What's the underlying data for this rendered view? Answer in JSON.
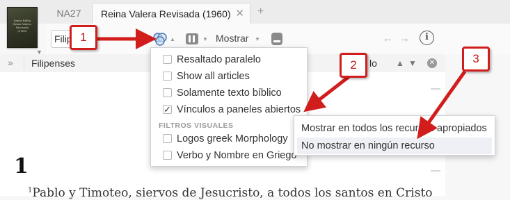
{
  "tabs": [
    {
      "label": "NA27",
      "active": false
    },
    {
      "label": "Reina Valera Revisada (1960)",
      "active": true
    }
  ],
  "tab_close_glyph": "✕",
  "tab_add_glyph": "+",
  "book_cover_text": "Santa Biblia Reina Valera Revisada (1960)",
  "toolbar": {
    "reference_value": "Filipenses",
    "visual_filters_icon": "venn-icon",
    "panel_icon": "pane-icon",
    "show_label": "Mostrar",
    "print_icon": "print-icon",
    "back_glyph": "←",
    "forward_glyph": "→",
    "info_glyph": "i"
  },
  "bar2": {
    "chevron": "»",
    "section_label": "Filipenses",
    "partial_label": "lo",
    "up_glyph": "▲",
    "down_glyph": "▼",
    "clear_glyph": "✕"
  },
  "menu": {
    "items": [
      {
        "label": "Resaltado paralelo",
        "checked": false
      },
      {
        "label": "Show all articles",
        "checked": false
      },
      {
        "label": "Solamente texto bíblico",
        "checked": false
      },
      {
        "label": "Vínculos a paneles abiertos",
        "checked": true
      }
    ],
    "section_title": "FILTROS VISUALES",
    "filter_items": [
      {
        "label": "Logos greek Morphology",
        "checked": false
      },
      {
        "label": "Verbo y Nombre en Griego",
        "checked": false
      }
    ],
    "check_glyph": "✓"
  },
  "submenu": {
    "items": [
      {
        "label": "Mostrar en todos los recursos apropiados",
        "hover": false
      },
      {
        "label": "No mostrar en ningún recurso",
        "hover": true
      }
    ]
  },
  "content": {
    "chapter": "1",
    "verse_number": "1",
    "verse_text": "Pablo y Timoteo, siervos de Jesucristo, a todos los santos en Cristo"
  },
  "callouts": [
    "1",
    "2",
    "3"
  ],
  "colors": {
    "callout_red": "#d21d1d",
    "hover_bg": "#eef0f6"
  }
}
